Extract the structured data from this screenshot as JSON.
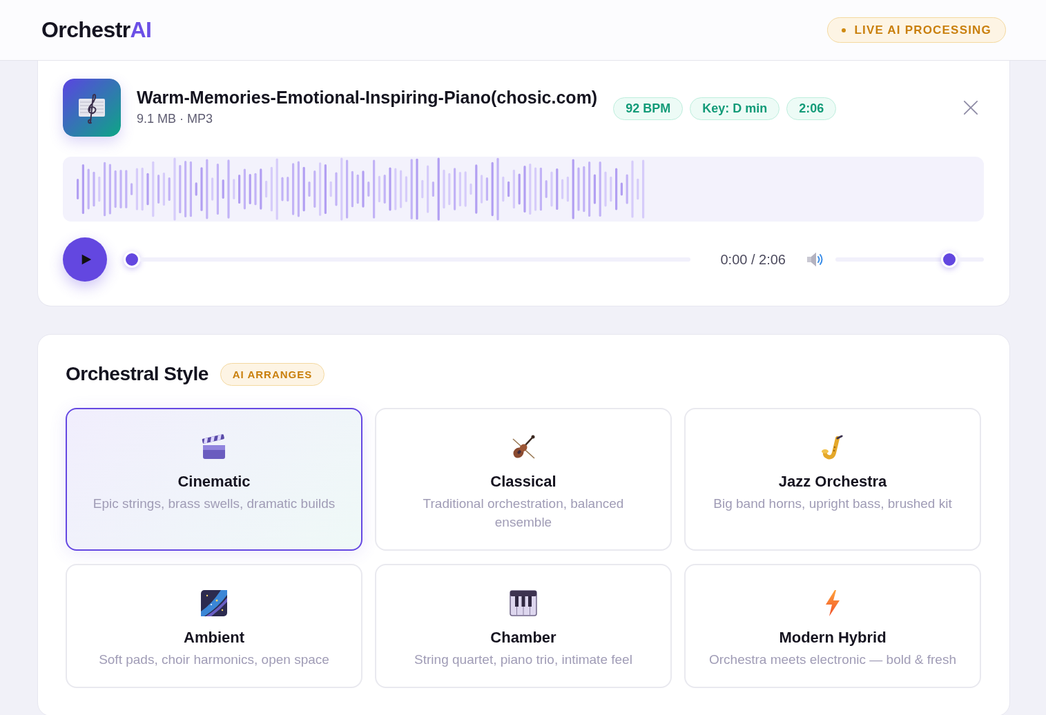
{
  "header": {
    "logo": {
      "text": "Orchestr",
      "accent": "AI"
    },
    "status_badge": "LIVE AI PROCESSING"
  },
  "track": {
    "title": "Warm-Memories-Emotional-Inspiring-Piano(chosic.com)",
    "meta": "9.1 MB · MP3",
    "tags": [
      "92 BPM",
      "Key: D min",
      "2:06"
    ],
    "player": {
      "playing": false,
      "progress": {
        "level": 0
      },
      "time": "0:00 / 2:06",
      "volume": {
        "level": 0.8
      }
    }
  },
  "styles": {
    "title": "Orchestral Style",
    "badge": "AI ARRANGES",
    "options": [
      {
        "name": "Cinematic",
        "description": "Epic strings, brass swells, dramatic builds",
        "selected": true
      },
      {
        "name": "Classical",
        "description": "Traditional orchestration, balanced ensemble",
        "selected": false
      },
      {
        "name": "Jazz Orchestra",
        "description": "Big band horns, upright bass, brushed kit",
        "selected": false
      },
      {
        "name": "Ambient",
        "description": "Soft pads, choir harmonics, open space",
        "selected": false
      },
      {
        "name": "Chamber",
        "description": "String quartet, piano trio, intimate feel",
        "selected": false
      },
      {
        "name": "Modern Hybrid",
        "description": "Orchestra meets electronic — bold & fresh",
        "selected": false
      }
    ]
  }
}
